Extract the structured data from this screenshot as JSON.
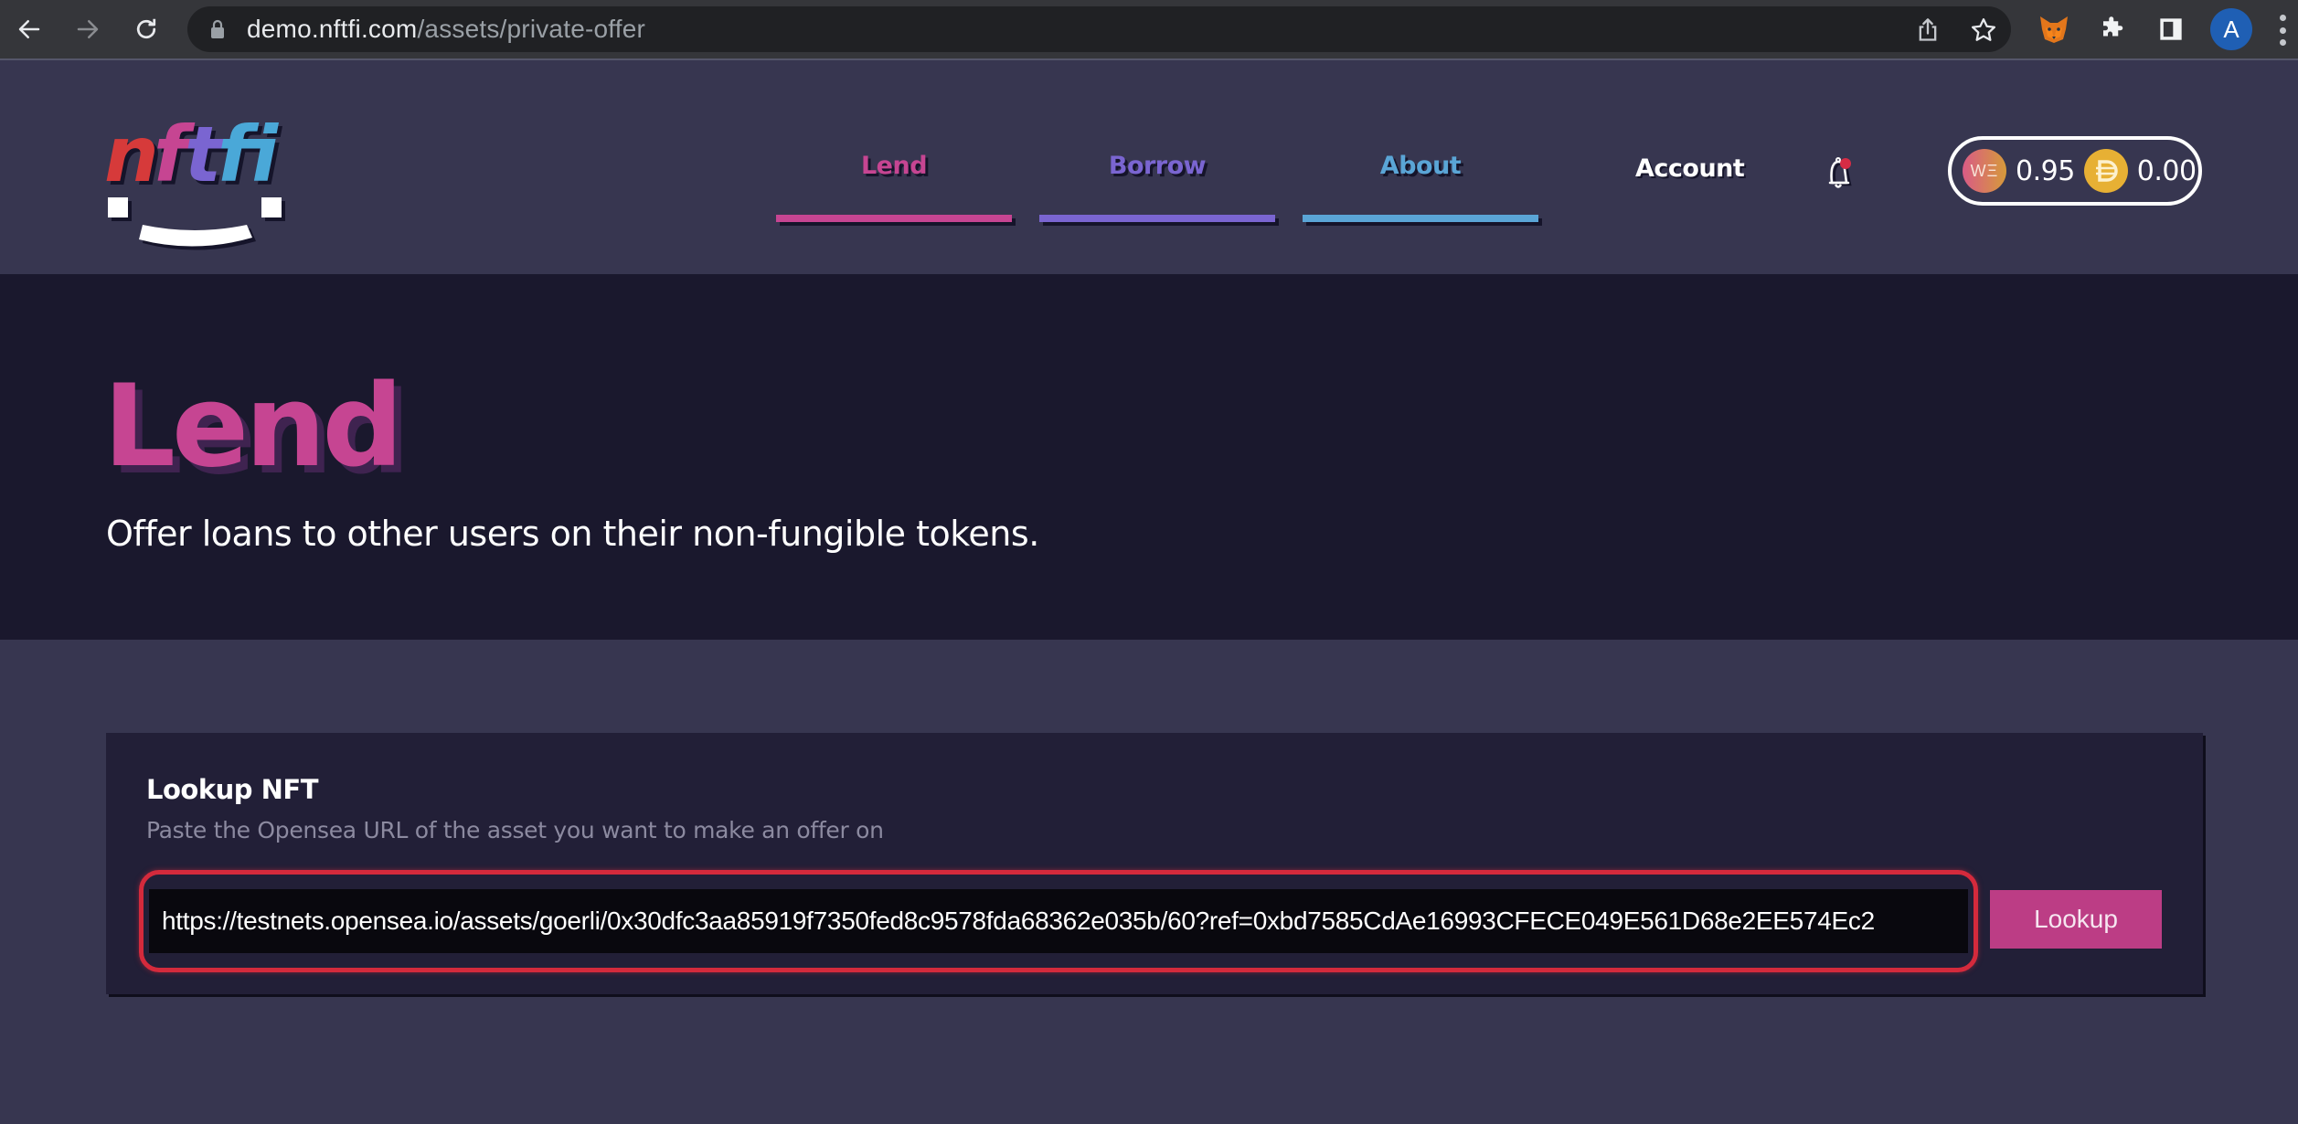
{
  "browser": {
    "url_host": "demo.nftfi.com",
    "url_path": "/assets/private-offer",
    "profile_initial": "A",
    "icons": [
      "back-icon",
      "forward-icon",
      "reload-icon",
      "lock-icon",
      "share-icon",
      "star-icon",
      "metamask-fox-icon",
      "extensions-puzzle-icon",
      "side-panel-icon",
      "kebab-menu-icon"
    ]
  },
  "header": {
    "logo_text": "nftfi",
    "nav": [
      {
        "label": "Lend",
        "color": "#c64592",
        "active": true
      },
      {
        "label": "Borrow",
        "color": "#7a65d1"
      },
      {
        "label": "About",
        "color": "#5aa5d6"
      }
    ],
    "account_label": "Account",
    "notification_dot_color": "#d62c45",
    "balances": [
      {
        "token": "WETH",
        "coin_label": "WΞ",
        "value": "0.95"
      },
      {
        "token": "DAI",
        "value": "0.00"
      }
    ]
  },
  "hero": {
    "title": "Lend",
    "subtitle": "Offer loans to other users on their non-fungible tokens."
  },
  "lookup": {
    "title": "Lookup NFT",
    "description": "Paste the Opensea URL of the asset you want to make an offer on",
    "input_value": "https://testnets.opensea.io/assets/goerli/0x30dfc3aa85919f7350fed8c9578fda68362e035b/60?ref=0xbd7585CdAe16993CFECE049E561D68e2EE574Ec2",
    "button_label": "Lookup",
    "highlight_color": "#d42a3c",
    "button_color": "#bc3d85"
  }
}
